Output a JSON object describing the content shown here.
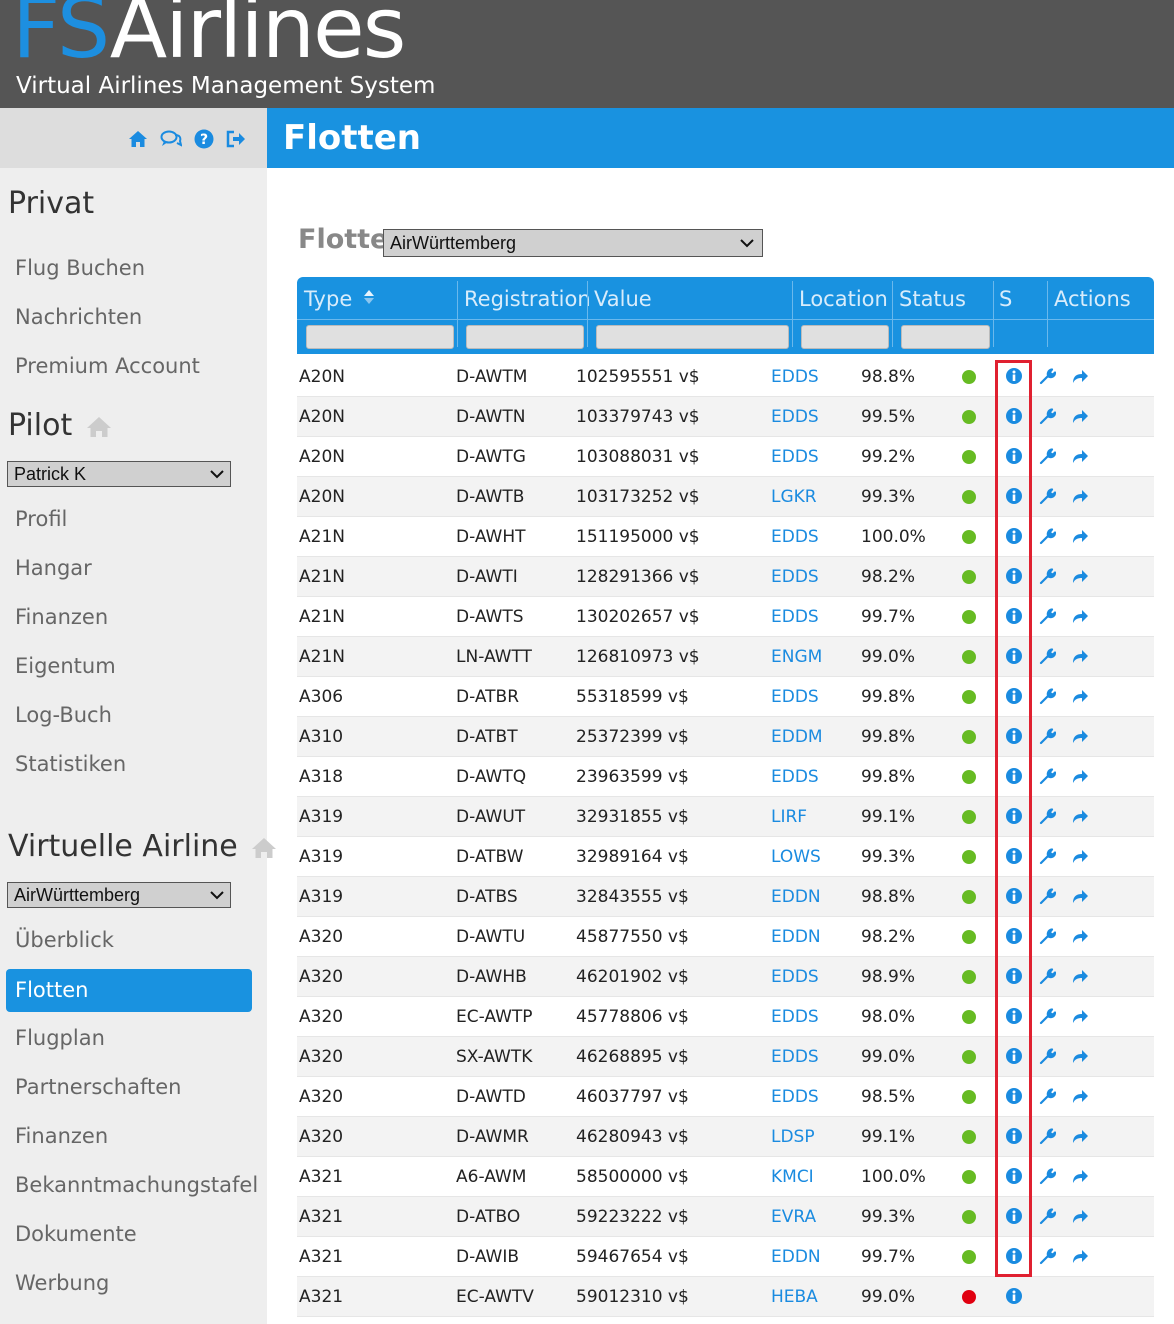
{
  "app": {
    "logo_fs": "FS",
    "logo_airlines": "Airlines",
    "tagline": "Virtual Airlines Management System"
  },
  "sidebar": {
    "top_icons": [
      "home-icon",
      "chat-icon",
      "help-icon",
      "logout-icon"
    ],
    "privat": {
      "title": "Privat",
      "items": [
        "Flug Buchen",
        "Nachrichten",
        "Premium Account"
      ]
    },
    "pilot": {
      "title": "Pilot",
      "selected": "Patrick K",
      "items": [
        "Profil",
        "Hangar",
        "Finanzen",
        "Eigentum",
        "Log-Buch",
        "Statistiken"
      ]
    },
    "airline": {
      "title": "Virtuelle Airline",
      "selected": "AirWürttemberg",
      "items": [
        "Überblick",
        "Flotten",
        "Flugplan",
        "Partnerschaften",
        "Finanzen",
        "Bekanntmachungstafel",
        "Dokumente",
        "Werbung"
      ],
      "active": "Flotten"
    }
  },
  "page": {
    "title": "Flotten",
    "fleet_label": "Flotte:",
    "fleet_selected": "AirWürttemberg"
  },
  "table": {
    "columns": [
      "Type",
      "Registration",
      "Value",
      "Location",
      "Status",
      "S",
      "Actions"
    ],
    "colors": {
      "ok": "#66bb22",
      "bad": "#e00010",
      "link": "#1a8be0"
    },
    "rows": [
      {
        "type": "A20N",
        "reg": "D-AWTM",
        "value": "102595551 v$",
        "loc": "EDDS",
        "status": "98.8%",
        "state": "ok",
        "actions": true
      },
      {
        "type": "A20N",
        "reg": "D-AWTN",
        "value": "103379743 v$",
        "loc": "EDDS",
        "status": "99.5%",
        "state": "ok",
        "actions": true
      },
      {
        "type": "A20N",
        "reg": "D-AWTG",
        "value": "103088031 v$",
        "loc": "EDDS",
        "status": "99.2%",
        "state": "ok",
        "actions": true
      },
      {
        "type": "A20N",
        "reg": "D-AWTB",
        "value": "103173252 v$",
        "loc": "LGKR",
        "status": "99.3%",
        "state": "ok",
        "actions": true
      },
      {
        "type": "A21N",
        "reg": "D-AWHT",
        "value": "151195000 v$",
        "loc": "EDDS",
        "status": "100.0%",
        "state": "ok",
        "actions": true
      },
      {
        "type": "A21N",
        "reg": "D-AWTI",
        "value": "128291366 v$",
        "loc": "EDDS",
        "status": "98.2%",
        "state": "ok",
        "actions": true
      },
      {
        "type": "A21N",
        "reg": "D-AWTS",
        "value": "130202657 v$",
        "loc": "EDDS",
        "status": "99.7%",
        "state": "ok",
        "actions": true
      },
      {
        "type": "A21N",
        "reg": "LN-AWTT",
        "value": "126810973 v$",
        "loc": "ENGM",
        "status": "99.0%",
        "state": "ok",
        "actions": true
      },
      {
        "type": "A306",
        "reg": "D-ATBR",
        "value": "55318599 v$",
        "loc": "EDDS",
        "status": "99.8%",
        "state": "ok",
        "actions": true
      },
      {
        "type": "A310",
        "reg": "D-ATBT",
        "value": "25372399 v$",
        "loc": "EDDM",
        "status": "99.8%",
        "state": "ok",
        "actions": true
      },
      {
        "type": "A318",
        "reg": "D-AWTQ",
        "value": "23963599 v$",
        "loc": "EDDS",
        "status": "99.8%",
        "state": "ok",
        "actions": true
      },
      {
        "type": "A319",
        "reg": "D-AWUT",
        "value": "32931855 v$",
        "loc": "LIRF",
        "status": "99.1%",
        "state": "ok",
        "actions": true
      },
      {
        "type": "A319",
        "reg": "D-ATBW",
        "value": "32989164 v$",
        "loc": "LOWS",
        "status": "99.3%",
        "state": "ok",
        "actions": true
      },
      {
        "type": "A319",
        "reg": "D-ATBS",
        "value": "32843555 v$",
        "loc": "EDDN",
        "status": "98.8%",
        "state": "ok",
        "actions": true
      },
      {
        "type": "A320",
        "reg": "D-AWTU",
        "value": "45877550 v$",
        "loc": "EDDN",
        "status": "98.2%",
        "state": "ok",
        "actions": true
      },
      {
        "type": "A320",
        "reg": "D-AWHB",
        "value": "46201902 v$",
        "loc": "EDDS",
        "status": "98.9%",
        "state": "ok",
        "actions": true
      },
      {
        "type": "A320",
        "reg": "EC-AWTP",
        "value": "45778806 v$",
        "loc": "EDDS",
        "status": "98.0%",
        "state": "ok",
        "actions": true
      },
      {
        "type": "A320",
        "reg": "SX-AWTK",
        "value": "46268895 v$",
        "loc": "EDDS",
        "status": "99.0%",
        "state": "ok",
        "actions": true
      },
      {
        "type": "A320",
        "reg": "D-AWTD",
        "value": "46037797 v$",
        "loc": "EDDS",
        "status": "98.5%",
        "state": "ok",
        "actions": true
      },
      {
        "type": "A320",
        "reg": "D-AWMR",
        "value": "46280943 v$",
        "loc": "LDSP",
        "status": "99.1%",
        "state": "ok",
        "actions": true
      },
      {
        "type": "A321",
        "reg": "A6-AWM",
        "value": "58500000 v$",
        "loc": "KMCI",
        "status": "100.0%",
        "state": "ok",
        "actions": true
      },
      {
        "type": "A321",
        "reg": "D-ATBO",
        "value": "59223222 v$",
        "loc": "EVRA",
        "status": "99.3%",
        "state": "ok",
        "actions": true
      },
      {
        "type": "A321",
        "reg": "D-AWIB",
        "value": "59467654 v$",
        "loc": "EDDN",
        "status": "99.7%",
        "state": "ok",
        "actions": true
      },
      {
        "type": "A321",
        "reg": "EC-AWTV",
        "value": "59012310 v$",
        "loc": "HEBA",
        "status": "99.0%",
        "state": "bad",
        "actions": false
      }
    ]
  }
}
